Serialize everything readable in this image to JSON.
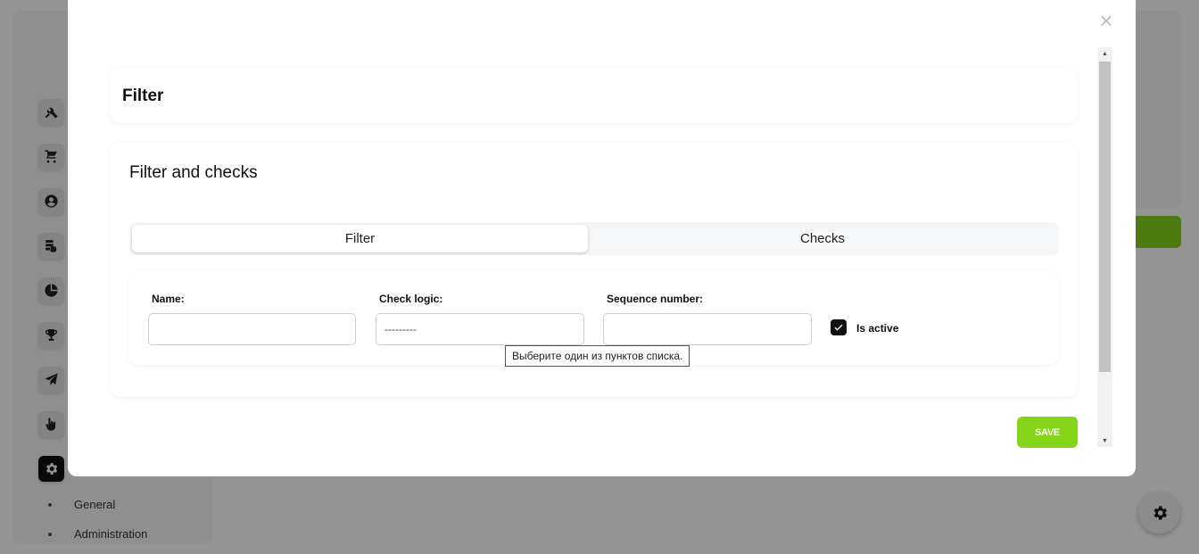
{
  "sidebar": {
    "icons": [
      "tools-icon",
      "cart-icon",
      "user-circle-icon",
      "database-icon",
      "pie-chart-icon",
      "trophy-icon",
      "paper-plane-icon",
      "hand-pointer-icon",
      "gear-icon"
    ],
    "active_icon": "gear-icon",
    "submenu": [
      {
        "label": "General"
      },
      {
        "label": "Administration"
      }
    ]
  },
  "modal": {
    "close_label": "×",
    "header_title": "Filter",
    "section_title": "Filter and checks",
    "tabs": [
      {
        "label": "Filter",
        "active": true
      },
      {
        "label": "Checks",
        "active": false
      }
    ],
    "form": {
      "name": {
        "label": "Name:",
        "value": ""
      },
      "check_logic": {
        "label": "Check logic:",
        "value": "---------"
      },
      "sequence_number": {
        "label": "Sequence number:",
        "value": ""
      },
      "is_active": {
        "label": "Is active",
        "checked": true
      }
    },
    "tooltip": "Выберите один из пунктов списка.",
    "save_label": "SAVE"
  },
  "colors": {
    "accent_green": "#84d41a",
    "overlay": "rgba(0,0,0,0.42)",
    "active_icon_bg": "#111111"
  }
}
